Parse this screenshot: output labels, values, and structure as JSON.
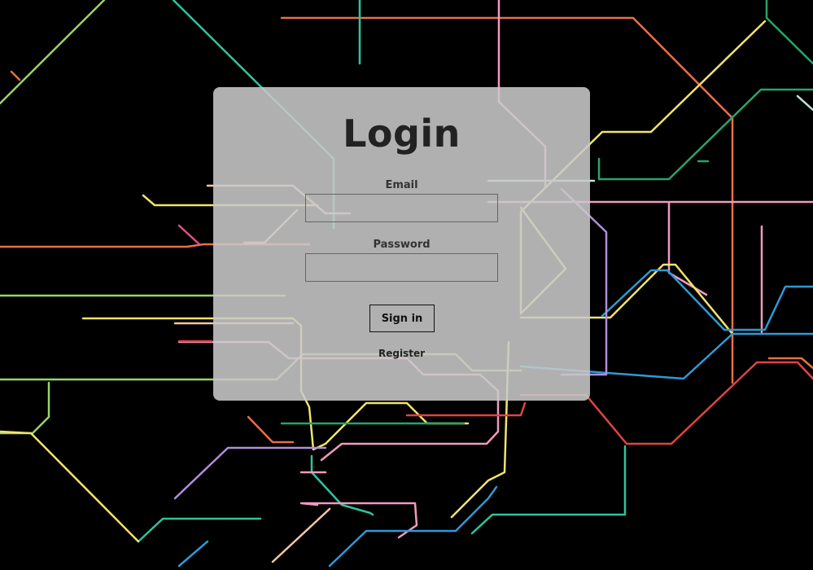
{
  "login": {
    "title": "Login",
    "email_label": "Email",
    "email_value": "",
    "password_label": "Password",
    "password_value": "",
    "signin_label": "Sign in",
    "register_label": "Register"
  },
  "background": {
    "description_icon": "transit-map-background",
    "colors": [
      "#e87a3c",
      "#9fd96a",
      "#2ec4a0",
      "#f1a3c8",
      "#f2e46b",
      "#4db3e6",
      "#e64646",
      "#b08fd8",
      "#2aa46a",
      "#e0508c",
      "#f5c6a0",
      "#b7e7d8"
    ]
  }
}
